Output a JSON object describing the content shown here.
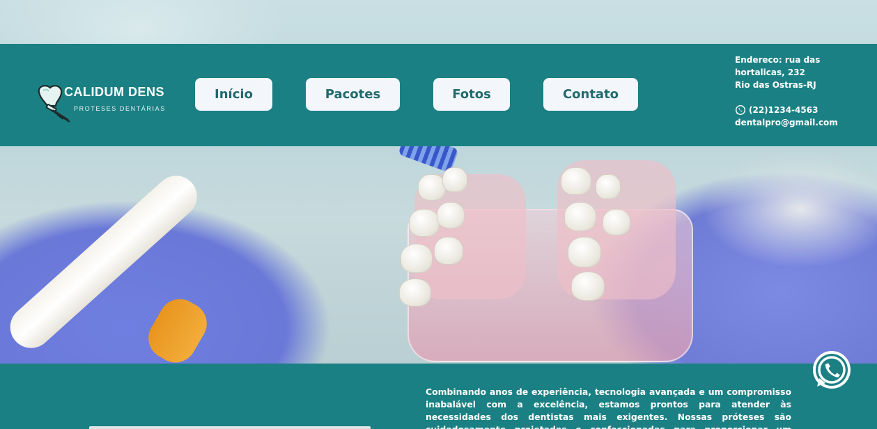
{
  "brand": {
    "name": "CALIDUM DENS",
    "tagline": "PROTESES DENTÁRIAS",
    "accent_color": "#1b8084",
    "button_bg": "#f3f6fa",
    "button_text_color": "#216a6e"
  },
  "nav": {
    "items": [
      {
        "label": "Início"
      },
      {
        "label": "Pacotes"
      },
      {
        "label": "Fotos"
      },
      {
        "label": "Contato"
      }
    ]
  },
  "contact": {
    "address_line1": "Endereco: rua das",
    "address_line2": "hortalicas, 232",
    "address_line3": "Rio das Ostras-RJ",
    "phone": "(22)1234-4563",
    "phone_icon": "whatsapp-icon",
    "email": "dentalpro@gmail.com"
  },
  "hero": {
    "image": "dental-model-with-toothbrush-photo"
  },
  "about": {
    "text": "Combinando anos de experiência, tecnologia avançada e um compromisso inabalável com a excelência, estamos prontos para atender às necessidades dos dentistas mais exigentes. Nossas próteses são cuidadosamente projetadas e confeccionadas para proporcionar um serviço natural e confortável aos"
  },
  "floating": {
    "icon": "whatsapp-icon"
  }
}
